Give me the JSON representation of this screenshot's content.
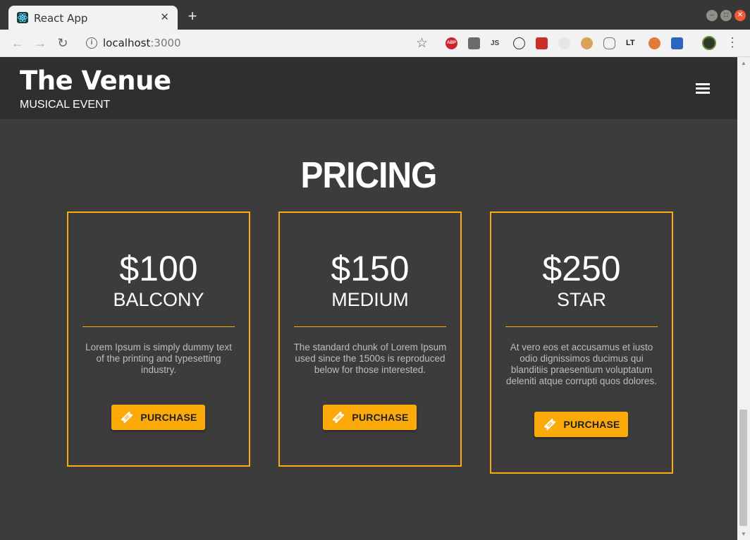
{
  "browser": {
    "tab_title": "React App",
    "tab_close": "✕",
    "new_tab": "+",
    "url_host": "localhost",
    "url_port": ":3000",
    "extensions": [
      "ABP",
      "JS",
      "LT"
    ]
  },
  "header": {
    "brand": "The Venue",
    "subtitle": "MUSICAL EVENT"
  },
  "pricing": {
    "title": "PRICING",
    "accent_color": "#fcaa0a",
    "cards": [
      {
        "price": "$100",
        "tier": "BALCONY",
        "description": "Lorem Ipsum is simply dummy text of the printing and typesetting industry.",
        "button": "PURCHASE"
      },
      {
        "price": "$150",
        "tier": "MEDIUM",
        "description": "The standard chunk of Lorem Ipsum used since the 1500s is reproduced below for those interested.",
        "button": "PURCHASE"
      },
      {
        "price": "$250",
        "tier": "STAR",
        "description": "At vero eos et accusamus et iusto odio dignissimos ducimus qui blanditiis praesentium voluptatum deleniti atque corrupti quos dolores.",
        "button": "PURCHASE"
      }
    ]
  }
}
